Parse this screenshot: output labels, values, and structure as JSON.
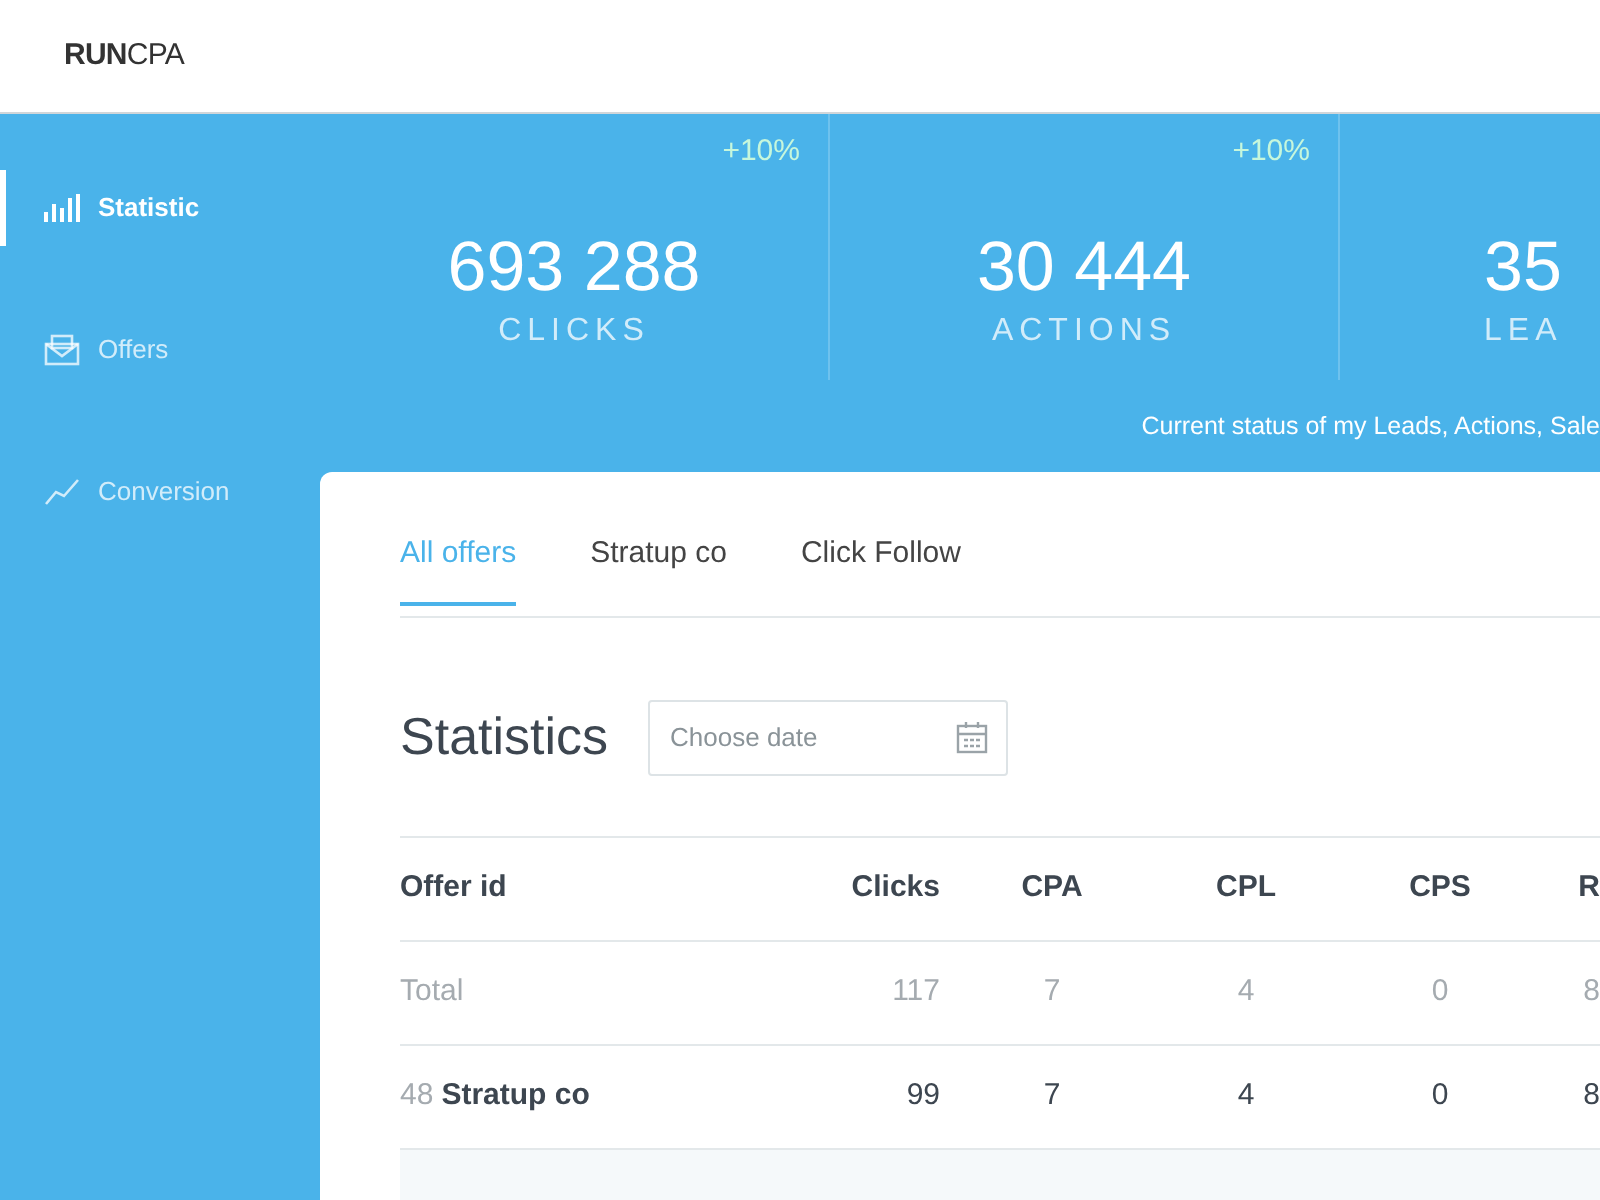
{
  "logo": {
    "bold": "RUN",
    "light": "CPA"
  },
  "sidebar": {
    "items": [
      {
        "label": "Statistic",
        "selected": true
      },
      {
        "label": "Offers",
        "selected": false
      },
      {
        "label": "Conversion",
        "selected": false
      }
    ]
  },
  "stats": [
    {
      "value": "693 288",
      "label": "CLICKS",
      "change": "+10%"
    },
    {
      "value": "30 444",
      "label": "ACTIONS",
      "change": "+10%"
    },
    {
      "value": "35",
      "label": "LEA"
    }
  ],
  "stats_caption": "Current status of my Leads, Actions, Sale",
  "tabs": [
    {
      "label": "All offers",
      "selected": true
    },
    {
      "label": "Stratup co",
      "selected": false
    },
    {
      "label": "Click Follow",
      "selected": false
    }
  ],
  "title": "Statistics",
  "date_field": {
    "placeholder": "Choose date"
  },
  "table": {
    "columns": [
      "Offer id",
      "Clicks",
      "CPA",
      "CPL",
      "CPS",
      "R"
    ],
    "rows": [
      {
        "kind": "total",
        "cells": [
          "Total",
          "117",
          "7",
          "4",
          "0",
          "8"
        ]
      },
      {
        "kind": "group",
        "id": "48",
        "cells": [
          "Stratup co",
          "99",
          "7",
          "4",
          "0",
          "8"
        ]
      }
    ]
  }
}
